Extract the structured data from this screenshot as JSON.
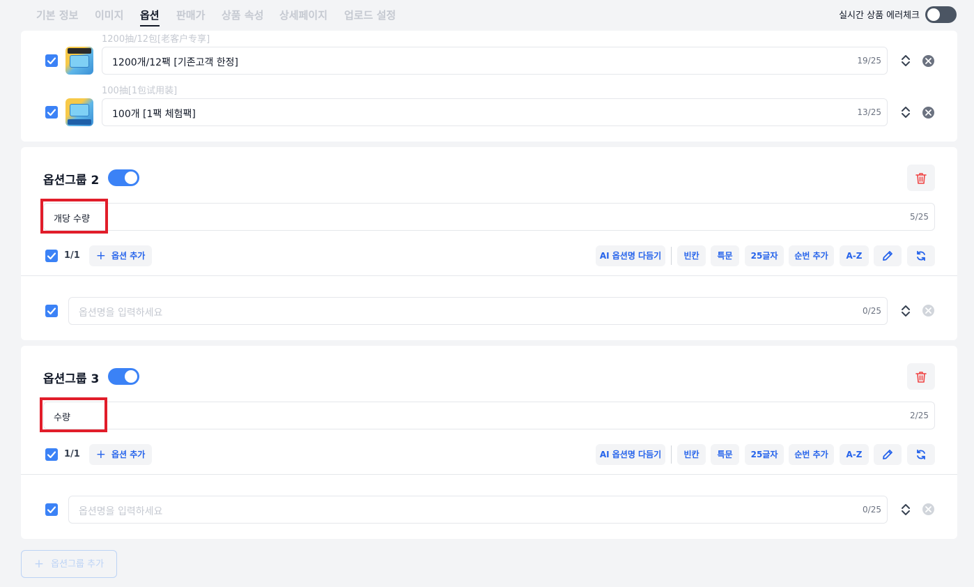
{
  "tabs": [
    {
      "label": "기본 정보"
    },
    {
      "label": "이미지"
    },
    {
      "label": "옵션"
    },
    {
      "label": "판매가"
    },
    {
      "label": "상품 속성"
    },
    {
      "label": "상세페이지"
    },
    {
      "label": "업로드 설정"
    }
  ],
  "active_tab": "옵션",
  "live_check": {
    "label": "실시간 상품 에러체크",
    "enabled": false
  },
  "group1_options": [
    {
      "source": "1200抽/12包[老客户专享]",
      "value": "1200개/12팩 [기존고객 한정]",
      "counter": "19/25",
      "checked": true
    },
    {
      "source": "100抽[1包试用装]",
      "value": "100개 [1팩 체험팩]",
      "counter": "13/25",
      "checked": true
    }
  ],
  "groups": [
    {
      "title": "옵션그룹 2",
      "enabled": true,
      "name_value": "개당 수량",
      "name_counter": "5/25",
      "selected_count": "1/1",
      "option_placeholder": "옵션명을 입력하세요",
      "option_counter": "0/25"
    },
    {
      "title": "옵션그룹 3",
      "enabled": true,
      "name_value": "수량",
      "name_counter": "2/25",
      "selected_count": "1/1",
      "option_placeholder": "옵션명을 입력하세요",
      "option_counter": "0/25"
    }
  ],
  "toolbar": {
    "add_option": "옵션 추가",
    "ai_refine": "AI 옵션명 다듬기",
    "blank": "빈칸",
    "special": "특문",
    "chars25": "25글자",
    "add_seq": "순번 추가",
    "az": "A-Z"
  },
  "add_group_label": "옵션그룹 추가",
  "colors": {
    "accent": "#3b82f6",
    "highlight": "#e11d2a",
    "danger": "#ef4444"
  }
}
